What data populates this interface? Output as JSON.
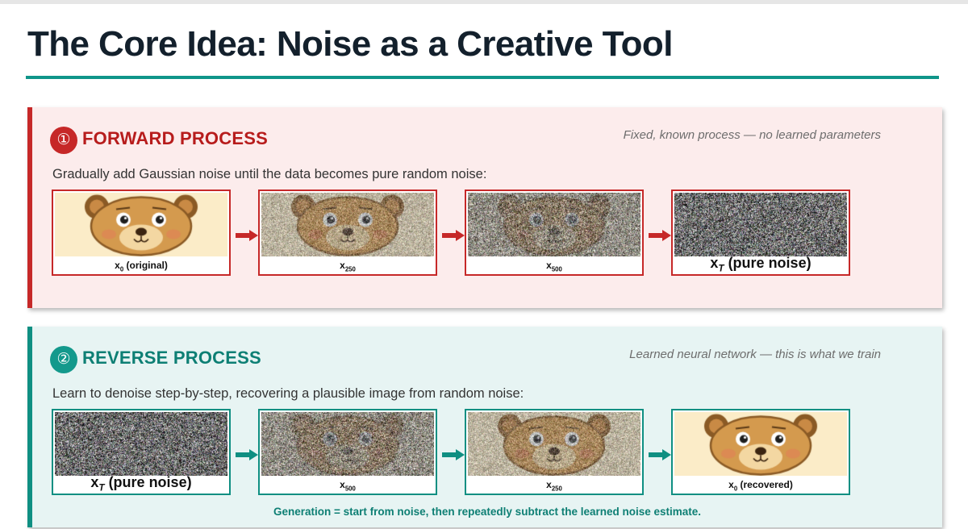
{
  "title": "The Core Idea: Noise as a Creative Tool",
  "colors": {
    "accent_teal": "#0f9589",
    "forward_red": "#c62828",
    "reverse_teal": "#0f8f82"
  },
  "forward": {
    "badge": "①",
    "title": "FORWARD PROCESS",
    "note": "Fixed, known process — no learned parameters",
    "description": "Gradually add Gaussian noise until the data becomes pure random noise:",
    "frames": [
      {
        "sym": "x",
        "sub": "0",
        "after": " (original)",
        "noise": 0.0
      },
      {
        "sym": "x",
        "sub": "250",
        "after": "",
        "noise": 0.45
      },
      {
        "sym": "x",
        "sub": "500",
        "after": "",
        "noise": 0.75
      },
      {
        "sym": "x",
        "sub": "T",
        "after": " (pure noise)",
        "noise": 1.0
      }
    ]
  },
  "reverse": {
    "badge": "②",
    "title": "REVERSE PROCESS",
    "note": "Learned neural network — this is what we train",
    "description": "Learn to denoise step-by-step, recovering a plausible image from random noise:",
    "frames": [
      {
        "sym": "x",
        "sub": "T",
        "after": " (pure noise)",
        "noise": 1.0
      },
      {
        "sym": "x",
        "sub": "500",
        "after": "",
        "noise": 0.75
      },
      {
        "sym": "x",
        "sub": "250",
        "after": "",
        "noise": 0.45
      },
      {
        "sym": "x",
        "sub": "0",
        "after": " (recovered)",
        "noise": 0.0
      }
    ],
    "footer": "Generation = start from noise, then repeatedly subtract the learned noise estimate."
  }
}
